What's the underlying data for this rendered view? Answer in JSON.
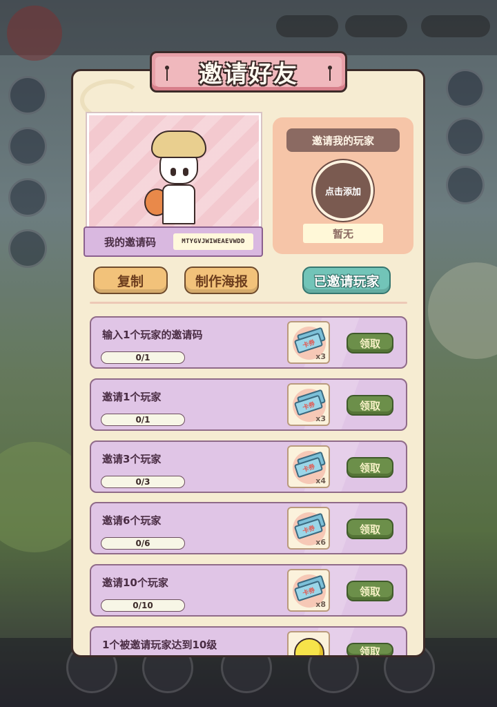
{
  "dialog": {
    "title": "邀请好友",
    "my_code_label": "我的邀请码",
    "my_code_value": "MTYGVJWIWEAEVWDD"
  },
  "inviter": {
    "header": "邀请我的玩家",
    "add_label": "点击添加",
    "none_label": "暂无"
  },
  "buttons": {
    "copy": "复制",
    "poster": "制作海报",
    "invited": "已邀请玩家"
  },
  "tasks": [
    {
      "title": "输入1个玩家的邀请码",
      "progress": "0/1",
      "reward_icon": "card-ticket-icon",
      "reward_qty": "x3",
      "claim": "领取"
    },
    {
      "title": "邀请1个玩家",
      "progress": "0/1",
      "reward_icon": "card-ticket-icon",
      "reward_qty": "x3",
      "claim": "领取"
    },
    {
      "title": "邀请3个玩家",
      "progress": "0/3",
      "reward_icon": "card-ticket-icon",
      "reward_qty": "x4",
      "claim": "领取"
    },
    {
      "title": "邀请6个玩家",
      "progress": "0/6",
      "reward_icon": "card-ticket-icon",
      "reward_qty": "x6",
      "claim": "领取"
    },
    {
      "title": "邀请10个玩家",
      "progress": "0/10",
      "reward_icon": "card-ticket-icon",
      "reward_qty": "x8",
      "claim": "领取"
    },
    {
      "title": "1个被邀请玩家达到10级",
      "reward_icon": "gold-coin-icon",
      "claim": "领取"
    }
  ],
  "ticket_label": "卡券",
  "colors": {
    "panel_bg": "#f6ecd2",
    "title_banner": "#e8a0a8",
    "task_bg": "#e0c5e6",
    "claim_button": "#6c8f4a",
    "invited_button": "#72c4b8",
    "action_button": "#f2c27a"
  }
}
